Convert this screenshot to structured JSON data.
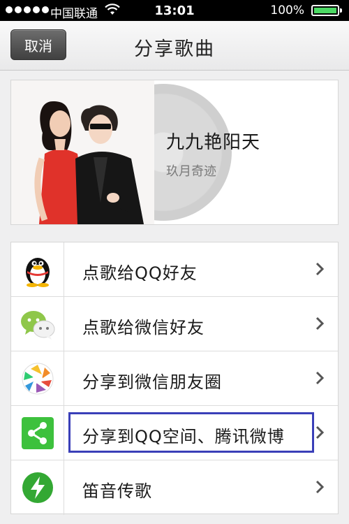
{
  "status_bar": {
    "carrier": "中国联通",
    "time": "13:01",
    "battery_percent": "100%"
  },
  "nav": {
    "cancel_label": "取消",
    "title": "分享歌曲"
  },
  "song": {
    "title": "九九艳阳天",
    "artist": "玖月奇迹"
  },
  "share_options": [
    {
      "label": "点歌给QQ好友",
      "icon": "qq-penguin-icon"
    },
    {
      "label": "点歌给微信好友",
      "icon": "wechat-icon"
    },
    {
      "label": "分享到微信朋友圈",
      "icon": "moments-icon"
    },
    {
      "label": "分享到QQ空间、腾讯微博",
      "icon": "share-icon",
      "highlighted": true
    },
    {
      "label": "笛音传歌",
      "icon": "lightning-icon"
    }
  ],
  "colors": {
    "highlight_border": "#3a3fb8",
    "battery_green": "#4cd964",
    "share_green": "#3dc13d"
  }
}
